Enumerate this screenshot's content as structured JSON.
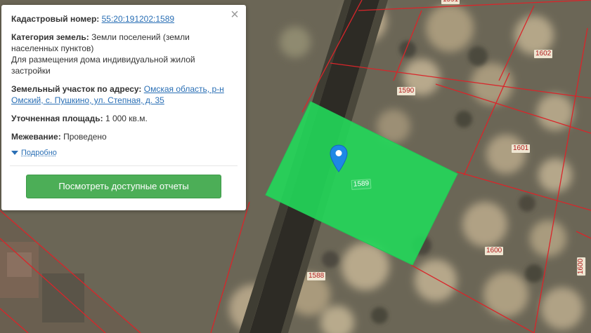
{
  "popup": {
    "cadastral_label": "Кадастровый номер:",
    "cadastral_number": "55:20:191202:1589",
    "category_label": "Категория земель:",
    "category_value_line1": "Земли поселений (земли",
    "category_value_line2": "населенных пунктов)",
    "purpose_line1": "Для размещения дома индивидуальной жилой",
    "purpose_line2": "застройки",
    "address_label": "Земельный участок по адресу:",
    "address_part1": "Омская область, р-н",
    "address_part2": "Омский, с. Пушкино, ул. Степная, д. 35",
    "area_label": "Уточненная площадь:",
    "area_value": "1 000 кв.м.",
    "survey_label": "Межевание:",
    "survey_value": "Проведено",
    "details_link": "Подробно",
    "reports_button": "Посмотреть доступные отчеты",
    "close_icon": "×"
  },
  "map": {
    "selected_parcel": "1589",
    "parcels": [
      "1590",
      "1602",
      "1601",
      "1600",
      "1588",
      "1600",
      "1591"
    ],
    "colors": {
      "selection_fill": "#22d85a",
      "boundary": "#d9252a",
      "button": "#4cae57",
      "link": "#2a6fb5"
    },
    "marker_icon": "map-pin-icon"
  }
}
